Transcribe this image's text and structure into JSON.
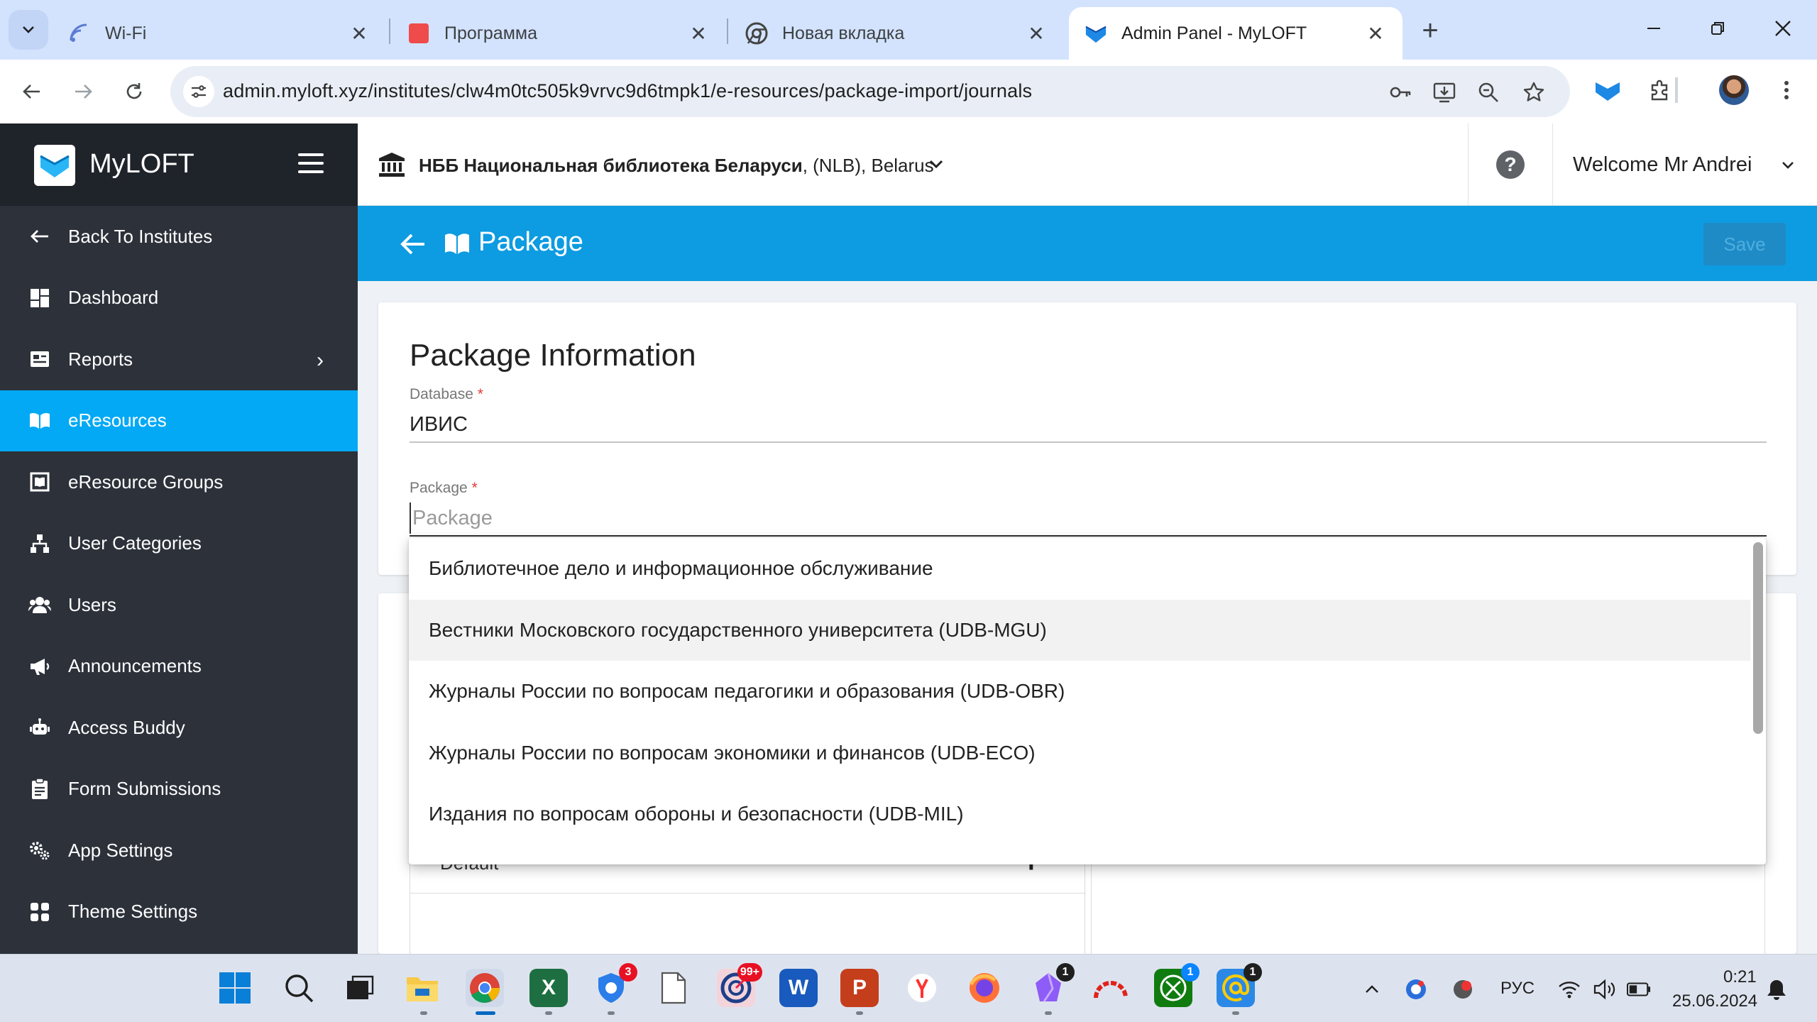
{
  "browser": {
    "tabs": [
      {
        "title": "Wi-Fi",
        "icon": "wifi-icon"
      },
      {
        "title": "Программа",
        "icon": "red-square-icon"
      },
      {
        "title": "Новая вкладка",
        "icon": "chrome-icon"
      },
      {
        "title": "Admin Panel - MyLOFT",
        "icon": "myloft-icon"
      }
    ],
    "url": "admin.myloft.xyz/institutes/clw4m0tc505k9vrvc9d6tmpk1/e-resources/package-import/journals"
  },
  "sidebar": {
    "brand": "MyLOFT",
    "items": [
      {
        "label": "Back To Institutes",
        "icon": "arrow-left-icon"
      },
      {
        "label": "Dashboard",
        "icon": "dashboard-icon"
      },
      {
        "label": "Reports",
        "icon": "reports-icon",
        "has_submenu": true
      },
      {
        "label": "eResources",
        "icon": "book-open-icon",
        "active": true
      },
      {
        "label": "eResource Groups",
        "icon": "resource-groups-icon"
      },
      {
        "label": "User Categories",
        "icon": "sitemap-icon"
      },
      {
        "label": "Users",
        "icon": "users-icon"
      },
      {
        "label": "Announcements",
        "icon": "megaphone-icon"
      },
      {
        "label": "Access Buddy",
        "icon": "robot-icon"
      },
      {
        "label": "Form Submissions",
        "icon": "form-icon"
      },
      {
        "label": "App Settings",
        "icon": "gears-icon"
      },
      {
        "label": "Theme Settings",
        "icon": "grid-icon"
      }
    ]
  },
  "header": {
    "institute_bold": "НББ Национальная библиотека Беларуси",
    "institute_rest": ", (NLB), Belarus",
    "welcome": "Welcome Mr Andrei"
  },
  "page": {
    "title": "Package",
    "save_label": "Save"
  },
  "form": {
    "section_title": "Package Information",
    "database_label": "Database",
    "database_value": "ИВИС",
    "package_label": "Package",
    "package_placeholder": "Package",
    "required_mark": "*"
  },
  "dropdown": {
    "options": [
      "Библиотечное дело и информационное обслуживание",
      "Вестники Московского государственного университета (UDB-MGU)",
      "Журналы России по вопросам педагогики и образования (UDB-OBR)",
      "Журналы России по вопросам экономики и финансов (UDB-ECO)",
      "Издания по вопросам обороны и безопасности (UDB-MIL)"
    ],
    "hovered_index": 1
  },
  "below": {
    "default_label": "Default",
    "add_symbol": "+"
  },
  "taskbar": {
    "badges": {
      "edge_like": "3",
      "app": "99+",
      "obsidian": "1",
      "xbox": "1",
      "mail": "1"
    },
    "language": "РУС",
    "time": "0:21",
    "date": "25.06.2024"
  },
  "colors": {
    "sidebar_bg": "#2c313a",
    "sidebar_brand_bg": "#1f232a",
    "accent": "#03a9f4",
    "page_header": "#0d9be1",
    "required": "#e53935"
  }
}
